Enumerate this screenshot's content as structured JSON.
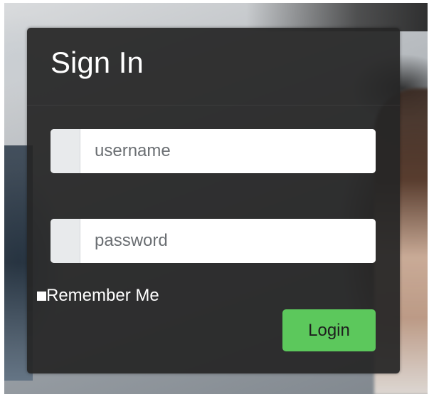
{
  "signin": {
    "title": "Sign In",
    "username": {
      "placeholder": "username",
      "value": ""
    },
    "password": {
      "placeholder": "password",
      "value": ""
    },
    "remember_label": "Remember Me",
    "remember_checked": false,
    "login_label": "Login"
  },
  "colors": {
    "panel_background": "#262626",
    "login_button": "#5cc85c",
    "input_addon": "#e8eaec",
    "title_text": "#ffffff"
  },
  "icons": {
    "username_addon": "user-icon",
    "password_addon": "lock-icon"
  }
}
